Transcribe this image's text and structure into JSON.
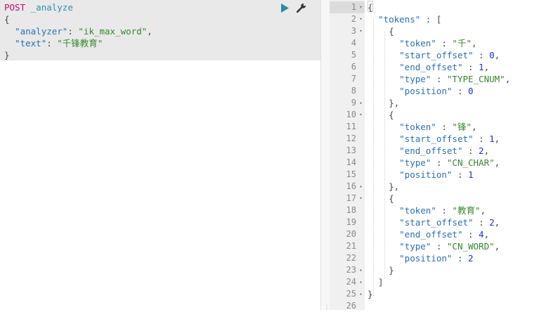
{
  "request": {
    "method": "POST",
    "endpoint": "_analyze",
    "lines": [
      {
        "key": "",
        "value": "{"
      },
      {
        "key": "\"analyzer\"",
        "value": "\"ik_max_word\""
      },
      {
        "key": "\"text\"",
        "value": "\"千锋教育\""
      },
      {
        "key": "",
        "value": "}"
      }
    ],
    "actions": {
      "run_icon": "play-triangle-icon",
      "settings_icon": "wrench-icon"
    }
  },
  "response": {
    "line_numbers": [
      "1",
      "2",
      "3",
      "4",
      "5",
      "6",
      "7",
      "8",
      "9",
      "10",
      "11",
      "12",
      "13",
      "14",
      "15",
      "16",
      "17",
      "18",
      "19",
      "20",
      "21",
      "22",
      "23",
      "24",
      "25",
      "26"
    ],
    "fold_markers": {
      "open": "▾",
      "close": "▴"
    },
    "tokens_key": "\"tokens\"",
    "tokens": [
      {
        "token": "\"千\"",
        "start_offset": "0",
        "end_offset": "1",
        "type": "\"TYPE_CNUM\"",
        "position": "0"
      },
      {
        "token": "\"锋\"",
        "start_offset": "1",
        "end_offset": "2",
        "type": "\"CN_CHAR\"",
        "position": "1"
      },
      {
        "token": "\"教育\"",
        "start_offset": "2",
        "end_offset": "4",
        "type": "\"CN_WORD\"",
        "position": "2"
      }
    ],
    "field_keys": {
      "token": "\"token\"",
      "start_offset": "\"start_offset\"",
      "end_offset": "\"end_offset\"",
      "type": "\"type\"",
      "position": "\"position\""
    }
  },
  "splitter": {
    "grip": "⋮"
  },
  "colors": {
    "method": "#c80a68",
    "endpoint": "#2e8fa8",
    "key": "#2b6fb4",
    "string": "#36862f",
    "number": "#1e2fd6",
    "selection": "#e9e9e9",
    "gutter": "#f0f0f0"
  }
}
